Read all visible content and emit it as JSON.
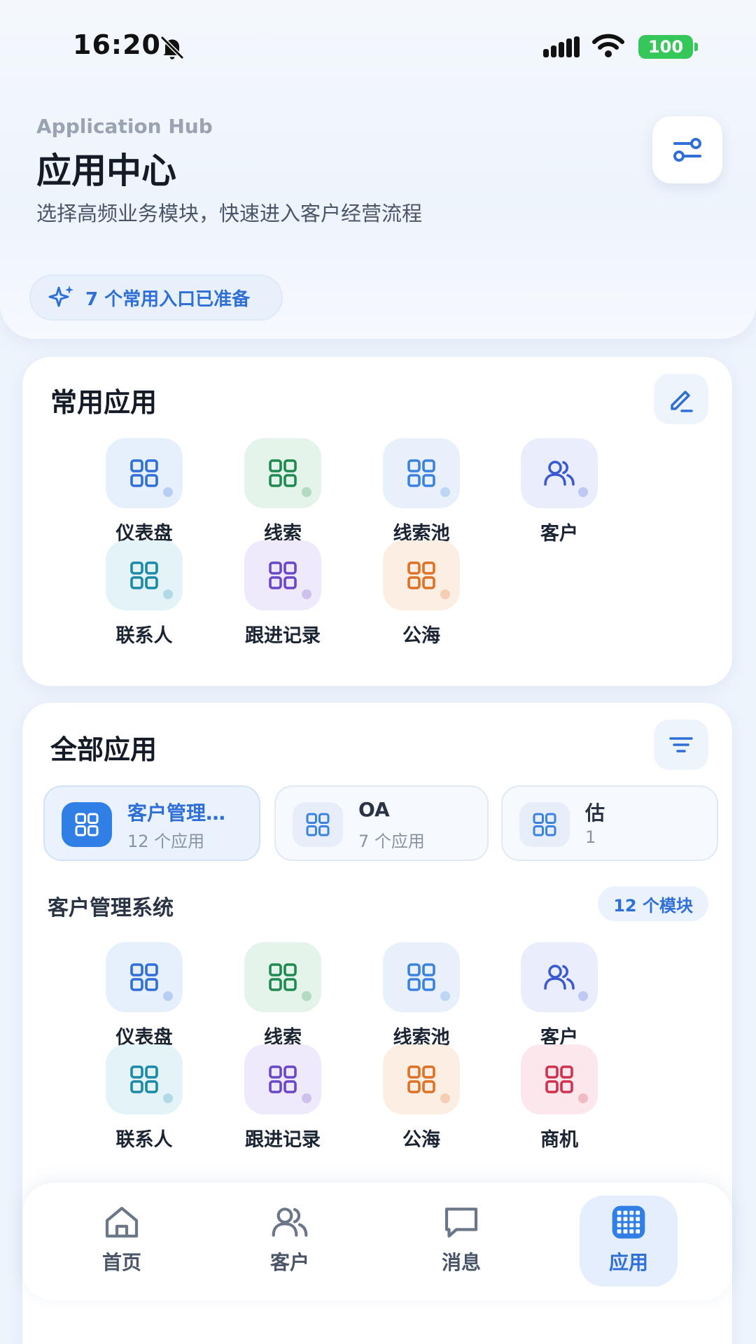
{
  "status_bar": {
    "time": "16:20",
    "battery": "100"
  },
  "header": {
    "subtitle": "Application Hub",
    "title": "应用中心",
    "description": "选择高频业务模块，快速进入客户经营流程",
    "ready_text": "7 个常用入口已准备"
  },
  "frequent": {
    "title": "常用应用",
    "apps": [
      {
        "label": "仪表盘",
        "icon": "grid-icon",
        "color": "#2f6fd6",
        "bg": "#e6effc"
      },
      {
        "label": "线索",
        "icon": "grid-icon",
        "color": "#1e8a50",
        "bg": "#e4f4ea"
      },
      {
        "label": "线索池",
        "icon": "grid-icon",
        "color": "#3b82e0",
        "bg": "#e8f0fc"
      },
      {
        "label": "客户",
        "icon": "users-icon",
        "color": "#3a58d0",
        "bg": "#eaeefc"
      },
      {
        "label": "联系人",
        "icon": "grid-icon",
        "color": "#1b8aa6",
        "bg": "#e4f3f8"
      },
      {
        "label": "跟进记录",
        "icon": "grid-icon",
        "color": "#6a47c9",
        "bg": "#efeafb"
      },
      {
        "label": "公海",
        "icon": "grid-icon",
        "color": "#e07024",
        "bg": "#fdeee3"
      }
    ]
  },
  "all_apps": {
    "title": "全部应用",
    "categories": [
      {
        "name": "客户管理…",
        "count": "12 个应用",
        "active": true
      },
      {
        "name": "OA",
        "count": "7 个应用",
        "active": false
      },
      {
        "name": "估",
        "count": "1",
        "active": false
      }
    ],
    "section_title": "客户管理系统",
    "module_count": "12 个模块",
    "apps": [
      {
        "label": "仪表盘",
        "icon": "grid-icon",
        "color": "#2f6fd6",
        "bg": "#e6effc"
      },
      {
        "label": "线索",
        "icon": "grid-icon",
        "color": "#1e8a50",
        "bg": "#e4f4ea"
      },
      {
        "label": "线索池",
        "icon": "grid-icon",
        "color": "#3b82e0",
        "bg": "#e8f0fc"
      },
      {
        "label": "客户",
        "icon": "users-icon",
        "color": "#3a58d0",
        "bg": "#eaeefc"
      },
      {
        "label": "联系人",
        "icon": "grid-icon",
        "color": "#1b8aa6",
        "bg": "#e4f3f8"
      },
      {
        "label": "跟进记录",
        "icon": "grid-icon",
        "color": "#6a47c9",
        "bg": "#efeafb"
      },
      {
        "label": "公海",
        "icon": "grid-icon",
        "color": "#e07024",
        "bg": "#fdeee3"
      },
      {
        "label": "商机",
        "icon": "grid-icon",
        "color": "#d0324e",
        "bg": "#fce8ec"
      }
    ]
  },
  "tabbar": {
    "items": [
      {
        "label": "首页",
        "icon": "home-icon",
        "active": false
      },
      {
        "label": "客户",
        "icon": "users-icon",
        "active": false
      },
      {
        "label": "消息",
        "icon": "message-icon",
        "active": false
      },
      {
        "label": "应用",
        "icon": "apps-icon",
        "active": true
      }
    ]
  }
}
